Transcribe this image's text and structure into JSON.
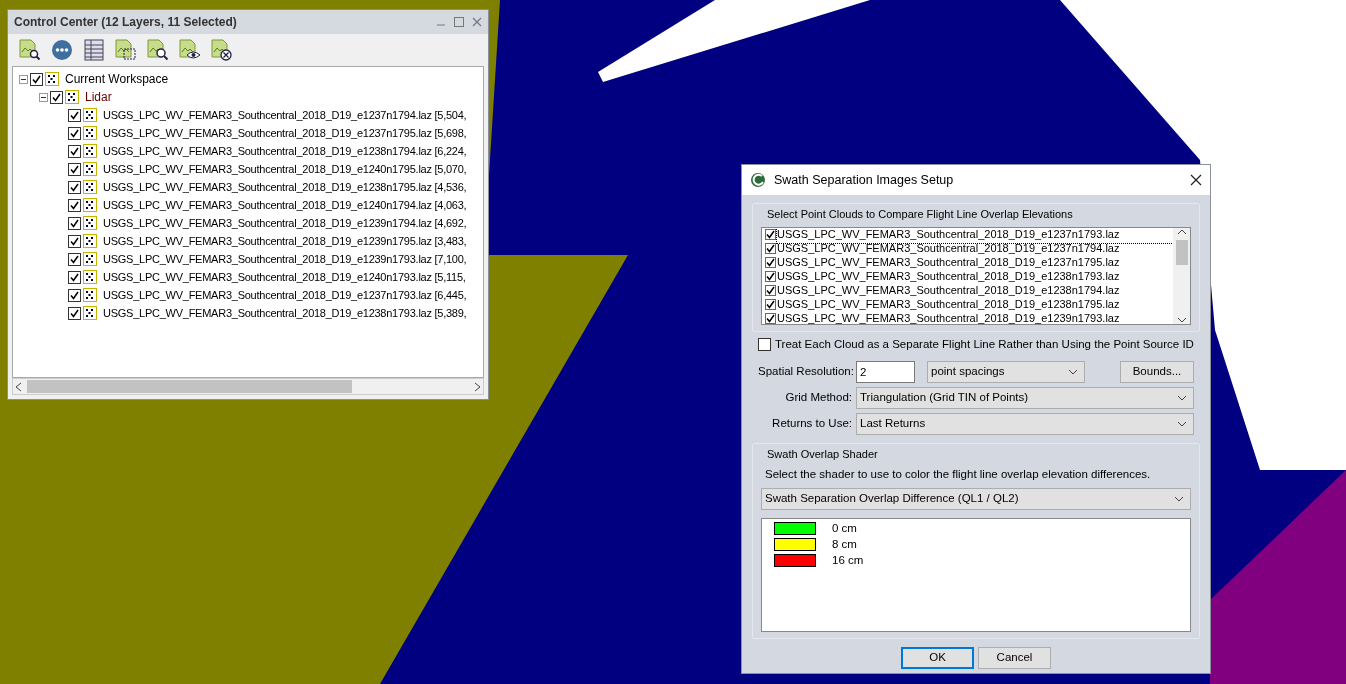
{
  "control_center": {
    "title": "Control Center (12 Layers, 11 Selected)",
    "tree": [
      {
        "label": "Current Workspace",
        "checked": true,
        "expanded": true,
        "children": [
          {
            "label": "Lidar",
            "checked": true,
            "expanded": true,
            "children": [
              {
                "label": "USGS_LPC_WV_FEMAR3_Southcentral_2018_D19_e1237n1794.laz [5,504,",
                "checked": true
              },
              {
                "label": "USGS_LPC_WV_FEMAR3_Southcentral_2018_D19_e1237n1795.laz [5,698,",
                "checked": true
              },
              {
                "label": "USGS_LPC_WV_FEMAR3_Southcentral_2018_D19_e1238n1794.laz [6,224,",
                "checked": true
              },
              {
                "label": "USGS_LPC_WV_FEMAR3_Southcentral_2018_D19_e1240n1795.laz [5,070,",
                "checked": true
              },
              {
                "label": "USGS_LPC_WV_FEMAR3_Southcentral_2018_D19_e1238n1795.laz [4,536,",
                "checked": true
              },
              {
                "label": "USGS_LPC_WV_FEMAR3_Southcentral_2018_D19_e1240n1794.laz [4,063,",
                "checked": true
              },
              {
                "label": "USGS_LPC_WV_FEMAR3_Southcentral_2018_D19_e1239n1794.laz [4,692,",
                "checked": true
              },
              {
                "label": "USGS_LPC_WV_FEMAR3_Southcentral_2018_D19_e1239n1795.laz [3,483,",
                "checked": true
              },
              {
                "label": "USGS_LPC_WV_FEMAR3_Southcentral_2018_D19_e1239n1793.laz [7,100,",
                "checked": true
              },
              {
                "label": "USGS_LPC_WV_FEMAR3_Southcentral_2018_D19_e1240n1793.laz [5,115,",
                "checked": true
              },
              {
                "label": "USGS_LPC_WV_FEMAR3_Southcentral_2018_D19_e1237n1793.laz [6,445,",
                "checked": true
              },
              {
                "label": "USGS_LPC_WV_FEMAR3_Southcentral_2018_D19_e1238n1793.laz [5,389,",
                "checked": true
              }
            ]
          }
        ]
      }
    ]
  },
  "dialog": {
    "title": "Swath Separation Images Setup",
    "clouds_group": {
      "title": "Select Point Clouds to Compare Flight Line Overlap Elevations",
      "items": [
        {
          "label": "USGS_LPC_WV_FEMAR3_Southcentral_2018_D19_e1237n1793.laz",
          "checked": true
        },
        {
          "label": "USGS_LPC_WV_FEMAR3_Southcentral_2018_D19_e1237n1794.laz",
          "checked": true
        },
        {
          "label": "USGS_LPC_WV_FEMAR3_Southcentral_2018_D19_e1237n1795.laz",
          "checked": true
        },
        {
          "label": "USGS_LPC_WV_FEMAR3_Southcentral_2018_D19_e1238n1793.laz",
          "checked": true
        },
        {
          "label": "USGS_LPC_WV_FEMAR3_Southcentral_2018_D19_e1238n1794.laz",
          "checked": true
        },
        {
          "label": "USGS_LPC_WV_FEMAR3_Southcentral_2018_D19_e1238n1795.laz",
          "checked": true
        },
        {
          "label": "USGS_LPC_WV_FEMAR3_Southcentral_2018_D19_e1239n1793.laz",
          "checked": true
        }
      ]
    },
    "separate_lines": {
      "label": "Treat Each Cloud as a Separate Flight Line Rather than Using the Point Source ID",
      "checked": false
    },
    "spatial_resolution": {
      "label": "Spatial Resolution:",
      "value": "2",
      "units": "point spacings",
      "button": "Bounds..."
    },
    "grid_method": {
      "label": "Grid Method:",
      "value": "Triangulation (Grid TIN of Points)"
    },
    "returns": {
      "label": "Returns to Use:",
      "value": "Last Returns"
    },
    "shader_group": {
      "title": "Swath Overlap Shader",
      "description": "Select the shader to use to color the flight line overlap elevation differences.",
      "value": "Swath Separation Overlap Difference (QL1 / QL2)",
      "legend": [
        {
          "label": "0 cm",
          "color": "#00ff00"
        },
        {
          "label": "8 cm",
          "color": "#ffff00"
        },
        {
          "label": "16 cm",
          "color": "#ff0000"
        }
      ]
    },
    "buttons": [
      {
        "label": "OK",
        "default": true
      },
      {
        "label": "Cancel",
        "default": false
      }
    ]
  }
}
